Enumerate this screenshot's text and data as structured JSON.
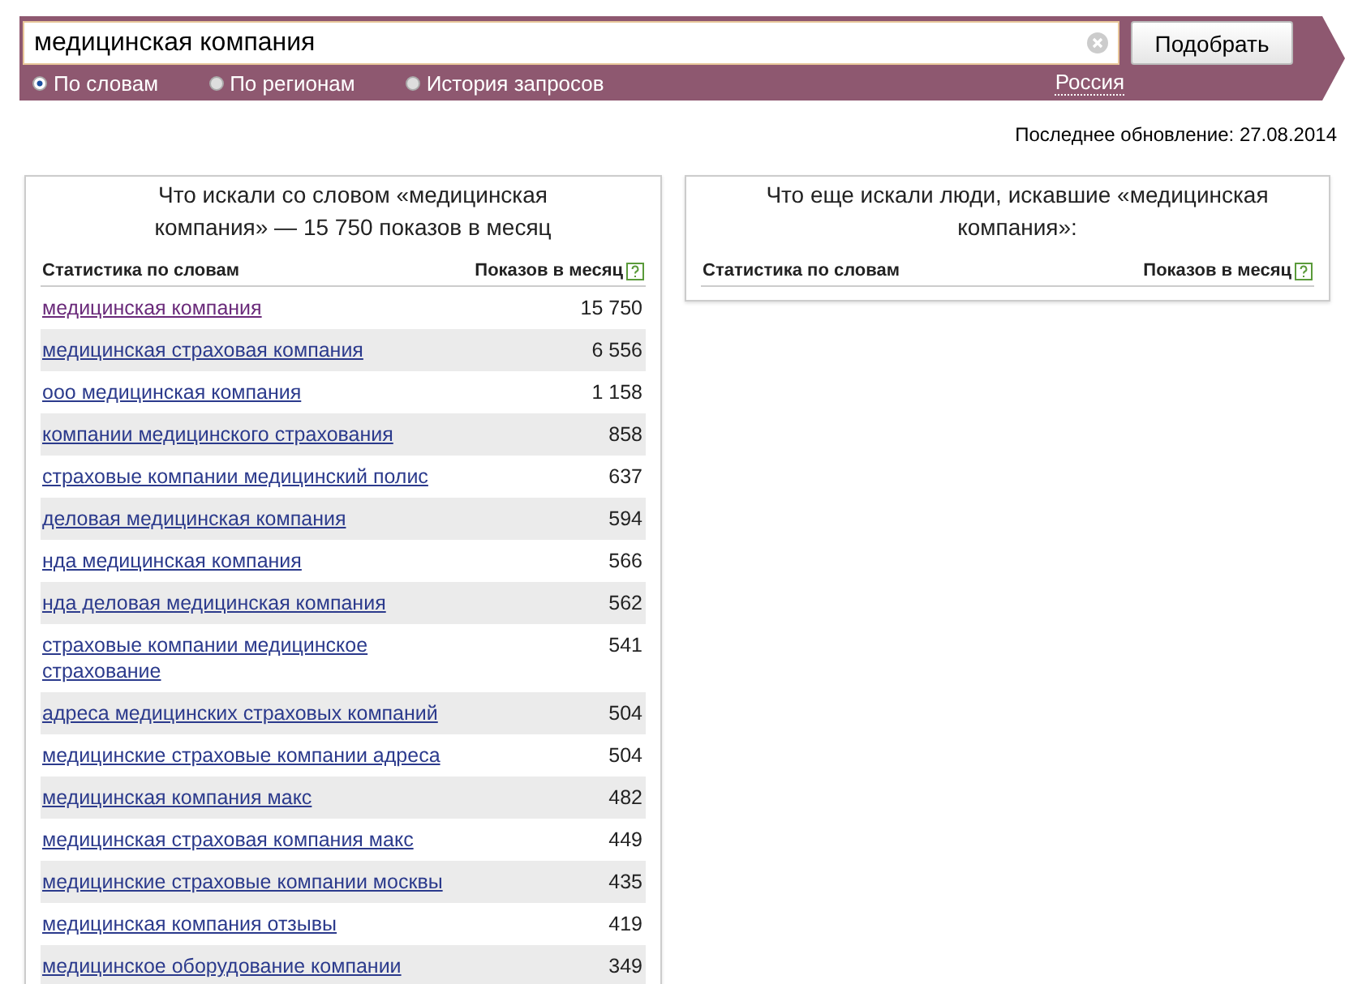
{
  "search": {
    "value": "медицинская компания",
    "button": "Подобрать",
    "modes": [
      {
        "label": "По словам",
        "selected": true
      },
      {
        "label": "По регионам",
        "selected": false
      },
      {
        "label": "История запросов",
        "selected": false
      }
    ],
    "region": "Россия"
  },
  "updated": "Последнее обновление: 27.08.2014",
  "left_panel": {
    "title": "Что искали со словом «медицинская компания» — 15 750 показов в месяц",
    "columns": [
      "Статистика по словам",
      "Показов в месяц"
    ],
    "rows": [
      {
        "phrase": "медицинская компания",
        "count": "15 750",
        "visited": true
      },
      {
        "phrase": "медицинская страховая компания",
        "count": "6 556",
        "visited": false
      },
      {
        "phrase": "ооо медицинская компания",
        "count": "1 158",
        "visited": false
      },
      {
        "phrase": "компании медицинского страхования",
        "count": "858",
        "visited": false
      },
      {
        "phrase": "страховые компании медицинский полис",
        "count": "637",
        "visited": false
      },
      {
        "phrase": "деловая медицинская компания",
        "count": "594",
        "visited": false
      },
      {
        "phrase": "нда медицинская компания",
        "count": "566",
        "visited": false
      },
      {
        "phrase": "нда деловая медицинская компания",
        "count": "562",
        "visited": false
      },
      {
        "phrase": "страховые компании медицинское страхование",
        "count": "541",
        "visited": false
      },
      {
        "phrase": "адреса медицинских страховых компаний",
        "count": "504",
        "visited": false
      },
      {
        "phrase": "медицинские страховые компании адреса",
        "count": "504",
        "visited": false
      },
      {
        "phrase": "медицинская компания макс",
        "count": "482",
        "visited": false
      },
      {
        "phrase": "медицинская страховая компания макс",
        "count": "449",
        "visited": false
      },
      {
        "phrase": "медицинские страховые компании москвы",
        "count": "435",
        "visited": false
      },
      {
        "phrase": "медицинская компания отзывы",
        "count": "419",
        "visited": false
      },
      {
        "phrase": "медицинское оборудование компании",
        "count": "349",
        "visited": false
      }
    ]
  },
  "right_panel": {
    "title": "Что еще искали люди, искавшие «медицинская компания»:",
    "columns": [
      "Статистика по словам",
      "Показов в месяц"
    ]
  }
}
